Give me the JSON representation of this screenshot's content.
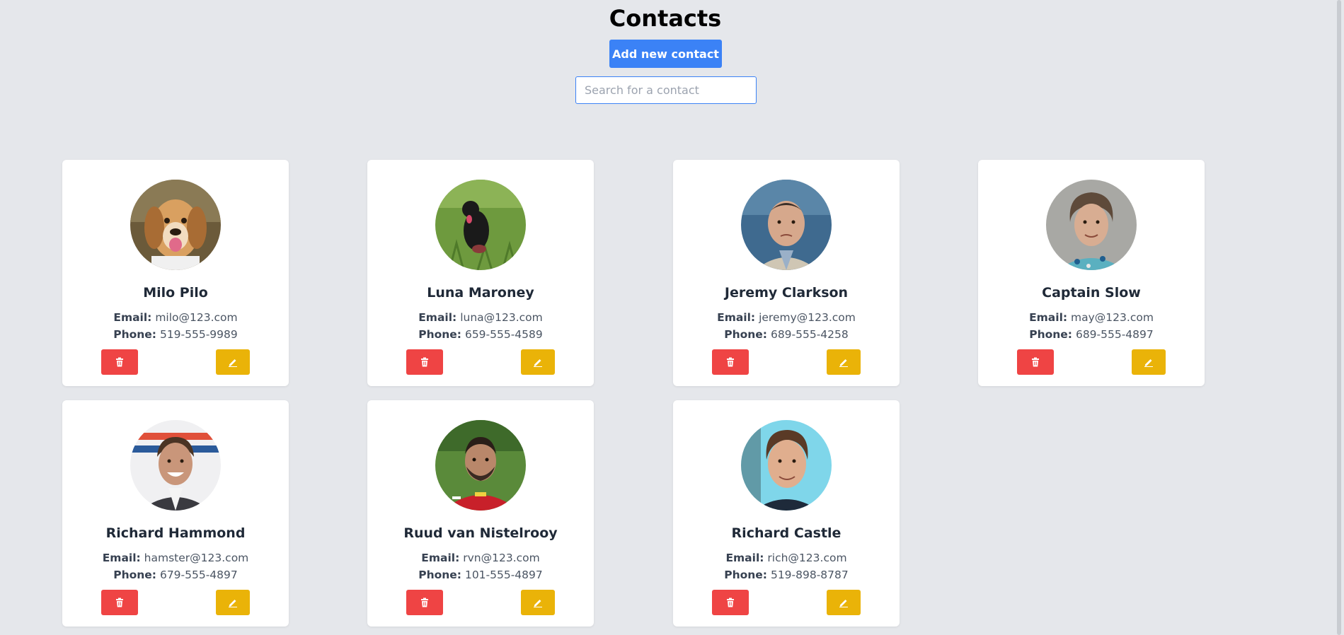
{
  "header": {
    "title": "Contacts",
    "add_label": "Add new contact",
    "search_placeholder": "Search for a contact",
    "search_value": ""
  },
  "labels": {
    "email": "Email:",
    "phone": "Phone:"
  },
  "colors": {
    "page_bg": "#e5e7eb",
    "primary": "#3b82f6",
    "danger": "#ef4444",
    "warning": "#eab308"
  },
  "icons": {
    "delete": "trash-icon",
    "edit": "pencil-icon"
  },
  "contacts": [
    {
      "name": "Milo Pilo",
      "email": "milo@123.com",
      "phone": "519-555-9989",
      "photo": "beagle dog"
    },
    {
      "name": "Luna Maroney",
      "email": "luna@123.com",
      "phone": "659-555-4589",
      "photo": "black dog in grass"
    },
    {
      "name": "Jeremy Clarkson",
      "email": "jeremy@123.com",
      "phone": "689-555-4258",
      "photo": "man portrait"
    },
    {
      "name": "Captain Slow",
      "email": "may@123.com",
      "phone": "689-555-4897",
      "photo": "man portrait"
    },
    {
      "name": "Richard Hammond",
      "email": "hamster@123.com",
      "phone": "679-555-4897",
      "photo": "man portrait"
    },
    {
      "name": "Ruud van Nistelrooy",
      "email": "rvn@123.com",
      "phone": "101-555-4897",
      "photo": "man in red jersey"
    },
    {
      "name": "Richard Castle",
      "email": "rich@123.com",
      "phone": "519-898-8787",
      "photo": "man portrait"
    }
  ]
}
